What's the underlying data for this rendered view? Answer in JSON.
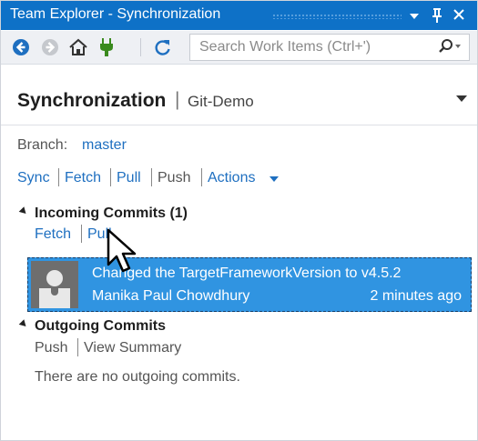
{
  "window": {
    "title": "Team Explorer - Synchronization",
    "controls": [
      "dropdown-icon",
      "pin-icon",
      "close-icon"
    ]
  },
  "toolbar": {
    "buttons": [
      "back-icon",
      "forward-icon",
      "home-icon",
      "connect-icon",
      "refresh-icon"
    ],
    "search_placeholder": "Search Work Items (Ctrl+')"
  },
  "header": {
    "title": "Synchronization",
    "separator": "|",
    "repo": "Git-Demo"
  },
  "branch": {
    "label": "Branch:",
    "name": "master"
  },
  "actions": {
    "sync": "Sync",
    "fetch": "Fetch",
    "pull": "Pull",
    "push": "Push",
    "more": "Actions"
  },
  "incoming": {
    "title": "Incoming Commits (1)",
    "fetch": "Fetch",
    "pull": "Pull",
    "commits": [
      {
        "message": "Changed the TargetFrameworkVersion to v4.5.2",
        "author": "Manika Paul Chowdhury",
        "time": "2 minutes ago"
      }
    ]
  },
  "outgoing": {
    "title": "Outgoing Commits",
    "push": "Push",
    "view_summary": "View Summary",
    "empty_message": "There are no outgoing commits."
  },
  "colors": {
    "title_bar": "#0e71c7",
    "link": "#1e6fc0",
    "selected_commit": "#3094e1"
  }
}
